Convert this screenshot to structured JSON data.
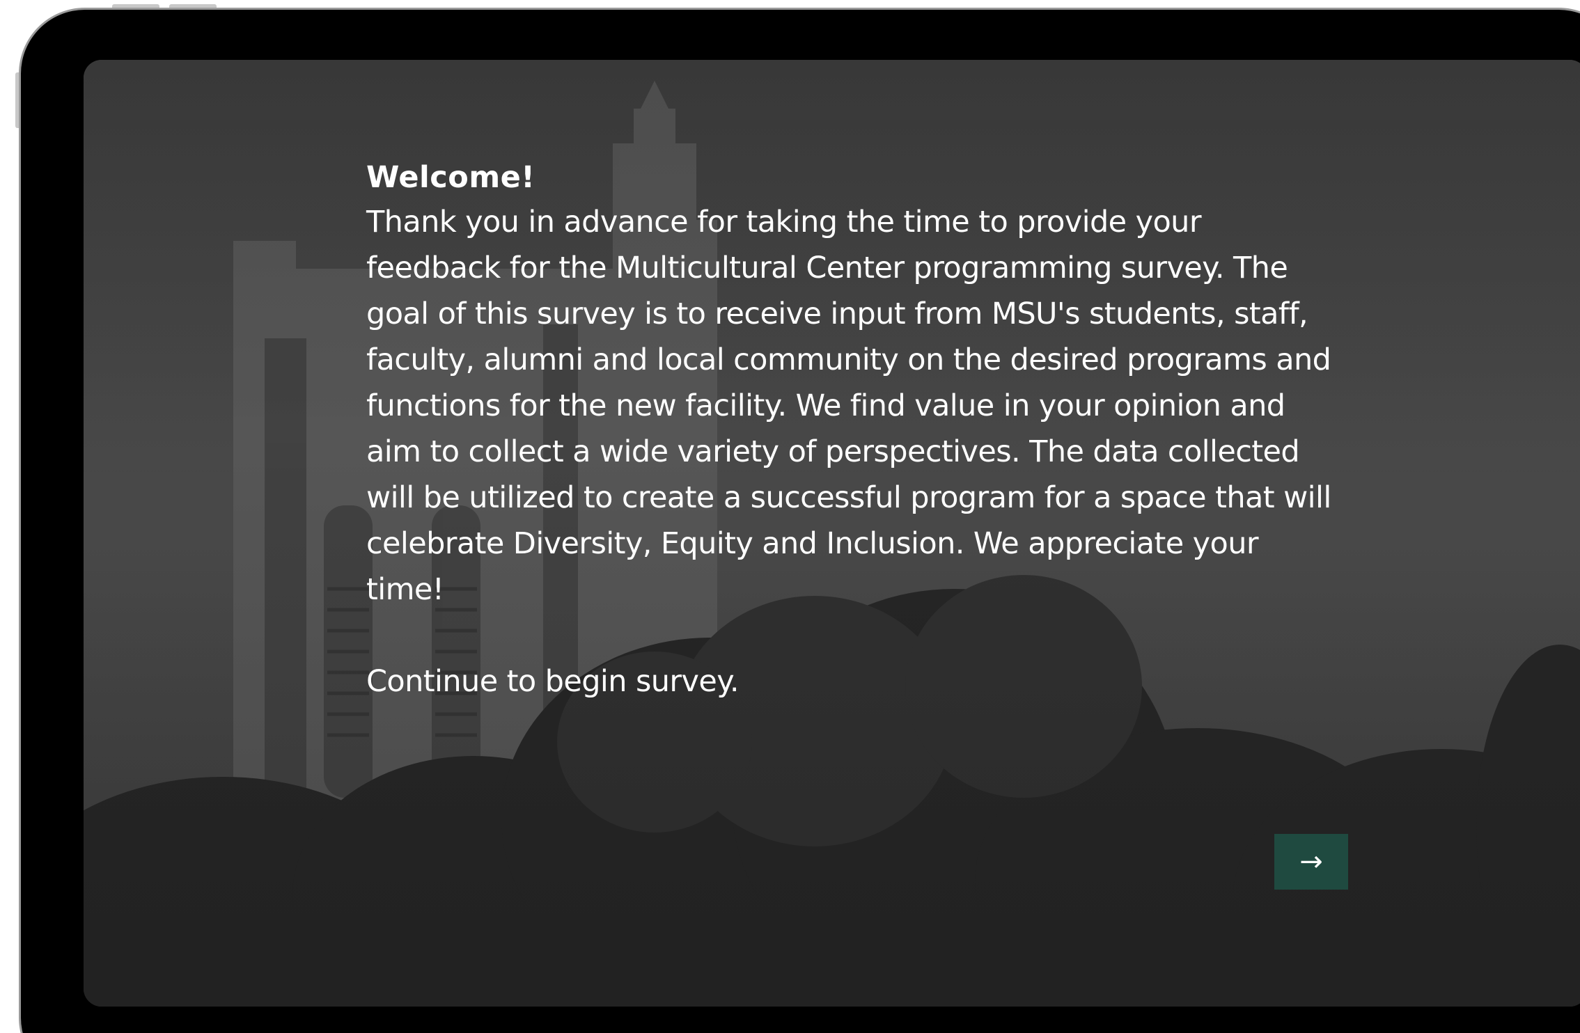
{
  "survey": {
    "heading": "Welcome!",
    "intro": "Thank you in advance for taking the time to provide your feedback for the Multicultural Center programming survey. The goal of this survey is to receive input from MSU's students, staff, faculty, alumni and local community on the desired programs and functions for the new facility. We find value in your opinion and aim to collect a wide variety of perspectives. The data collected will be utilized to create a successful program for a space that will celebrate Diversity, Equity and Inclusion. We appreciate your time!",
    "continue_prompt": "Continue to begin survey."
  },
  "navigation": {
    "next_icon": "→",
    "next_icon_name": "arrow-right-icon"
  },
  "theme": {
    "button_color": "#1f4a40",
    "text_color": "#ffffff"
  }
}
